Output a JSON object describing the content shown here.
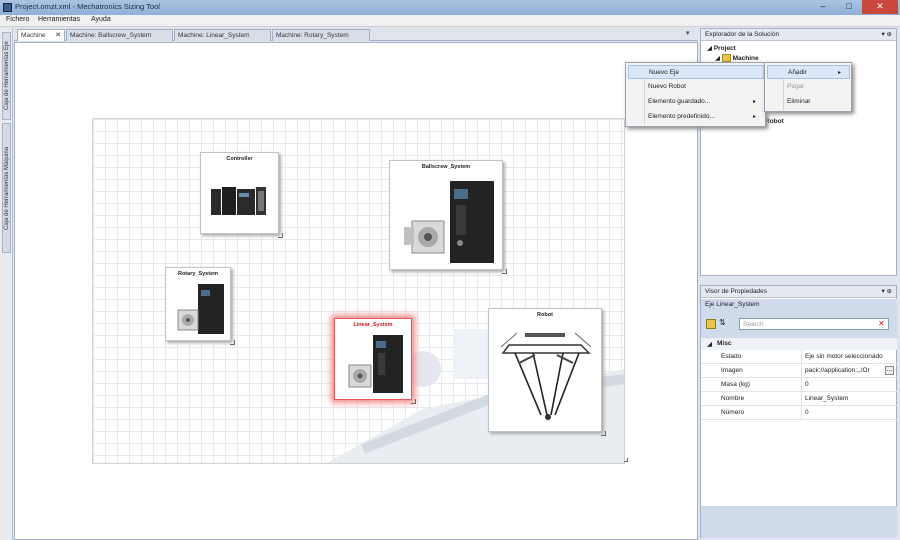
{
  "window": {
    "title": "Project.omzt.xml - Mechatronics Sizing Tool"
  },
  "menubar": {
    "items": [
      "Fichero",
      "Herramientas",
      "Ayuda"
    ]
  },
  "left_strip": {
    "tabs": [
      "Caja de Herramientas Eje",
      "Caja de Herramientas Máquina"
    ]
  },
  "tabs": [
    {
      "label": "Machine",
      "active": true
    },
    {
      "label": "Machine: Ballscrew_System"
    },
    {
      "label": "Machine: Linear_System"
    },
    {
      "label": "Machine: Rotary_System"
    }
  ],
  "canvas": {
    "nodes": [
      {
        "label": "Controller"
      },
      {
        "label": "Ballscrew_System"
      },
      {
        "label": "Rotary_System"
      },
      {
        "label": "Linear_System",
        "selected": true
      },
      {
        "label": "Robot"
      }
    ]
  },
  "context_menu": {
    "items": [
      "Nuevo Eje",
      "Nuevo Robot",
      "Elemento guardado...",
      "Elemento predefinido..."
    ],
    "submenu": [
      "Añadir",
      "Pegar",
      "Eliminar"
    ]
  },
  "solution_explorer": {
    "title": "Explorador de la Solución",
    "tree": [
      "Project",
      "Machine",
      "Robot"
    ]
  },
  "properties": {
    "title": "Visor de Propiedades",
    "object": "Eje Linear_System",
    "search_placeholder": "Search",
    "category": "Misc",
    "rows": [
      {
        "key": "Estado",
        "value": "Eje sin motor seleccionado"
      },
      {
        "key": "Imagen",
        "value": "pack://application:,,/Or"
      },
      {
        "key": "Masa (kg)",
        "value": "0"
      },
      {
        "key": "Nombre",
        "value": "Linear_System"
      },
      {
        "key": "Número",
        "value": "0"
      }
    ]
  },
  "colors": {
    "selection": "#e35a5a",
    "accent": "#8fb0d8"
  }
}
